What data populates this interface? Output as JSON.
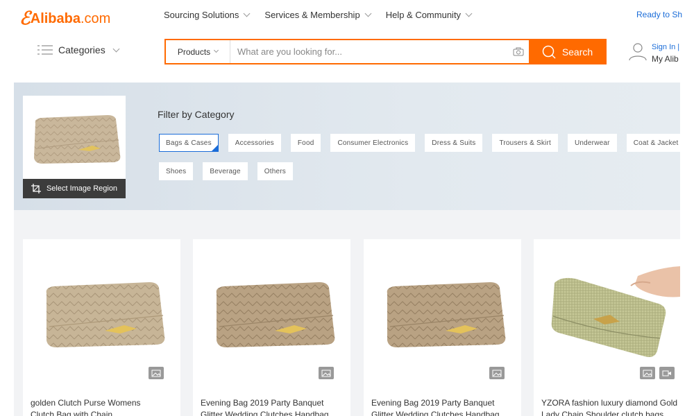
{
  "header": {
    "logo_text": "Alibaba",
    "logo_suffix": ".com",
    "nav": [
      {
        "label": "Sourcing Solutions"
      },
      {
        "label": "Services & Membership"
      },
      {
        "label": "Help & Community"
      }
    ],
    "ready": "Ready to Sh",
    "categories_label": "Categories",
    "search": {
      "type_label": "Products",
      "placeholder": "What are you looking for...",
      "button_label": "Search"
    },
    "account": {
      "signin": "Sign In |",
      "my_alibaba": "My Alib"
    }
  },
  "filter": {
    "select_region_label": "Select Image Region",
    "title": "Filter by Category",
    "categories": [
      {
        "label": "Bags & Cases",
        "active": true
      },
      {
        "label": "Accessories"
      },
      {
        "label": "Food"
      },
      {
        "label": "Consumer Electronics"
      },
      {
        "label": "Dress & Suits"
      },
      {
        "label": "Trousers & Skirt"
      },
      {
        "label": "Underwear"
      },
      {
        "label": "Coat & Jacket"
      },
      {
        "label": "Shoes"
      },
      {
        "label": "Beverage"
      },
      {
        "label": "Others"
      }
    ]
  },
  "products": [
    {
      "title_1": "golden Clutch Purse Womens",
      "title_2": "Clutch Bag with Chain"
    },
    {
      "title_1": "Evening Bag 2019 Party Banquet",
      "title_2": "Glitter Wedding Clutches Handbag"
    },
    {
      "title_1": "Evening Bag 2019 Party Banquet",
      "title_2": "Glitter Wedding Clutches Handbag"
    },
    {
      "title_1": "YZORA fashion luxury diamond Gold",
      "title_2": "Lady Chain Shoulder clutch bags"
    }
  ],
  "colors": {
    "accent": "#ff6a00",
    "link": "#1a6cd8"
  }
}
